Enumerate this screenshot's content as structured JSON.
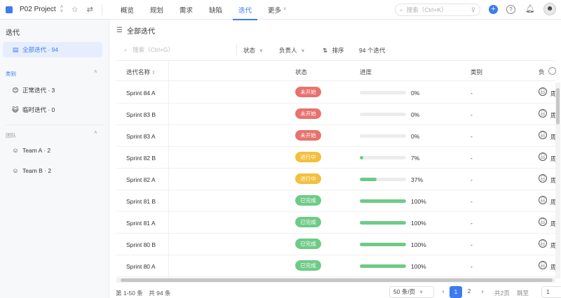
{
  "topbar": {
    "project_name": "P02 Project",
    "nav": [
      "概览",
      "规划",
      "需求",
      "缺陷",
      "迭代",
      "更多"
    ],
    "active_nav": 4,
    "search_placeholder": "搜索（Ctrl+K）",
    "accent": "#3c7cf0"
  },
  "sidebar": {
    "title": "迭代",
    "all_item": "全部迭代 · 94",
    "group_type": "类别",
    "type_items": [
      "正常迭代 · 3",
      "临时迭代 · 0"
    ],
    "group_team": "团队",
    "team_items": [
      "Team A · 2",
      "Team B · 2"
    ]
  },
  "main": {
    "title": "全部迭代",
    "search_placeholder": "搜索（Ctrl+G）",
    "filter_status": "状态",
    "filter_owner": "负责人",
    "sort": "排序",
    "count": "94 个迭代"
  },
  "table": {
    "headers": [
      "迭代名称",
      "状态",
      "进度",
      "类别",
      "负"
    ],
    "rows": [
      {
        "name": "Sprint 84 A",
        "status": "未开始",
        "color": "red",
        "progress": 0,
        "progress_text": "0%",
        "type": "-",
        "owner": "周"
      },
      {
        "name": "Sprint 83 B",
        "status": "未开始",
        "color": "red",
        "progress": 0,
        "progress_text": "0%",
        "type": "-",
        "owner": "周"
      },
      {
        "name": "Sprint 83 A",
        "status": "未开始",
        "color": "red",
        "progress": 0,
        "progress_text": "0%",
        "type": "-",
        "owner": "周"
      },
      {
        "name": "Sprint 82 B",
        "status": "进行中",
        "color": "yellow",
        "progress": 7,
        "progress_text": "7%",
        "type": "-",
        "owner": "周"
      },
      {
        "name": "Sprint 82 A",
        "status": "进行中",
        "color": "yellow",
        "progress": 37,
        "progress_text": "37%",
        "type": "-",
        "owner": "周"
      },
      {
        "name": "Sprint 81 B",
        "status": "已完成",
        "color": "green",
        "progress": 100,
        "progress_text": "100%",
        "type": "-",
        "owner": "周"
      },
      {
        "name": "Sprint 81 A",
        "status": "已完成",
        "color": "green",
        "progress": 100,
        "progress_text": "100%",
        "type": "-",
        "owner": "周"
      },
      {
        "name": "Sprint 80 B",
        "status": "已完成",
        "color": "green",
        "progress": 100,
        "progress_text": "100%",
        "type": "-",
        "owner": "周"
      },
      {
        "name": "Sprint 80 A",
        "status": "已完成",
        "color": "green",
        "progress": 100,
        "progress_text": "100%",
        "type": "-",
        "owner": "周"
      }
    ]
  },
  "footer": {
    "range": "第 1-50 条　共 94 条",
    "page_size": "50 条/页",
    "pages": [
      "1",
      "2"
    ],
    "total_pages": "共2页",
    "jump_label": "跳至",
    "jump_value": "1"
  }
}
